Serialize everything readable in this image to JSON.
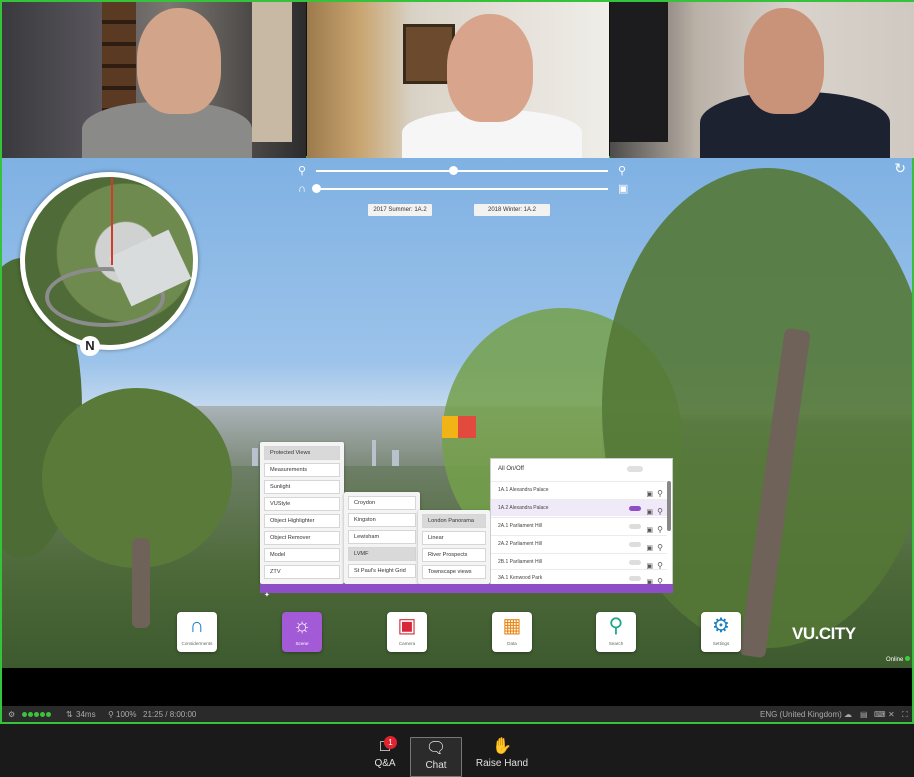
{
  "viewport": {
    "sliders": {
      "zoom_out_icon": "zoom-out-icon",
      "zoom_in_icon": "zoom-in-icon",
      "magnet_icon": "magnet-icon",
      "camera_icon": "camera-icon",
      "zoom_level": 0.47,
      "time_level": 0.0
    },
    "time_chips": [
      "2017 Summer: 1A.2",
      "2018 Winter: 1A.2"
    ],
    "compass_label": "N",
    "refresh_icon": "refresh-icon"
  },
  "menu": {
    "col1": [
      "Protected Views",
      "Measurements",
      "Sunlight",
      "VUStyle",
      "Object Highlighter",
      "Object Remover",
      "Model",
      "ZTV"
    ],
    "col2": [
      "Croydon",
      "Kingston",
      "Lewisham",
      "LVMF",
      "St Paul's Height Grid"
    ],
    "col3": [
      "London Panorama",
      "Linear",
      "River Prospects",
      "Townscape views"
    ],
    "bottom_icon": "settings-small-icon"
  },
  "layers": {
    "header": "All On/Off",
    "rows": [
      "1A.1 Alexandra Palace",
      "1A.2 Alexandra Palace",
      "2A.1 Parliament Hill",
      "2A.2 Parliament Hill",
      "2B.1 Parliament Hill",
      "3A.1 Kenwood Park"
    ]
  },
  "dock": {
    "buttons": [
      {
        "label": "Considerments",
        "icon": "vu-logo-icon"
      },
      {
        "label": "Scene",
        "icon": "sun-icon"
      },
      {
        "label": "Camera",
        "icon": "camera-icon"
      },
      {
        "label": "Data",
        "icon": "puzzle-icon"
      },
      {
        "label": "Search",
        "icon": "search-icon"
      },
      {
        "label": "Settings",
        "icon": "gear-icon"
      }
    ],
    "logo": "VU.CITY",
    "online_label": "Online"
  },
  "statusbar": {
    "latency": "34ms",
    "zoom": "100%",
    "time": "21:25 / 8:00:00",
    "language": "ENG (United Kingdom)"
  },
  "zoom_controls": {
    "qa_label": "Q&A",
    "qa_badge": "1",
    "chat_label": "Chat",
    "raise_hand_label": "Raise Hand"
  },
  "colors": {
    "active_speaker": "#36c23a",
    "accent_purple": "#8e4ec6",
    "badge_red": "#e0242f"
  }
}
